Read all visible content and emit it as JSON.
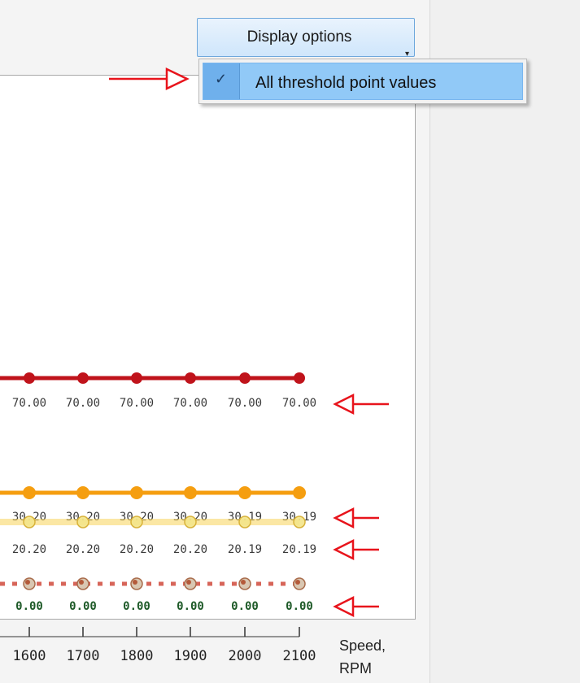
{
  "toolbar": {
    "display_options_label": "Display options"
  },
  "display_menu": {
    "items": [
      {
        "label": "All threshold point values",
        "checked": true
      }
    ]
  },
  "colors": {
    "red_series": "#c0131b",
    "orange_series": "#f59e10",
    "yellow_series": "#f7d35a",
    "bottom_series": "#d04a3c",
    "annotation_arrow": "#e8141c",
    "label_dark": "#3a3a3a",
    "label_green": "#1e5a28"
  },
  "chart_data": {
    "type": "line",
    "x": [
      1600,
      1700,
      1800,
      1900,
      2000,
      2100
    ],
    "xlabel": [
      "Speed,",
      "RPM"
    ],
    "tick_labels": [
      "1600",
      "1700",
      "1800",
      "1900",
      "2000",
      "2100"
    ],
    "series": [
      {
        "values": [
          70.0,
          70.0,
          70.0,
          70.0,
          70.0,
          70.0
        ],
        "labels": [
          "70.00",
          "70.00",
          "70.00",
          "70.00",
          "70.00",
          "70.00"
        ]
      },
      {
        "values": [
          30.2,
          30.2,
          30.2,
          30.2,
          30.19,
          30.19
        ],
        "labels": [
          "30.20",
          "30.20",
          "30.20",
          "30.20",
          "30.19",
          "30.19"
        ]
      },
      {
        "values": [
          20.2,
          20.2,
          20.2,
          20.2,
          20.19,
          20.19
        ],
        "labels": [
          "20.20",
          "20.20",
          "20.20",
          "20.20",
          "20.19",
          "20.19"
        ]
      },
      {
        "values": [
          0.0,
          0.0,
          0.0,
          0.0,
          0.0,
          0.0
        ],
        "labels": [
          "0.00",
          "0.00",
          "0.00",
          "0.00",
          "0.00",
          "0.00"
        ]
      }
    ]
  }
}
